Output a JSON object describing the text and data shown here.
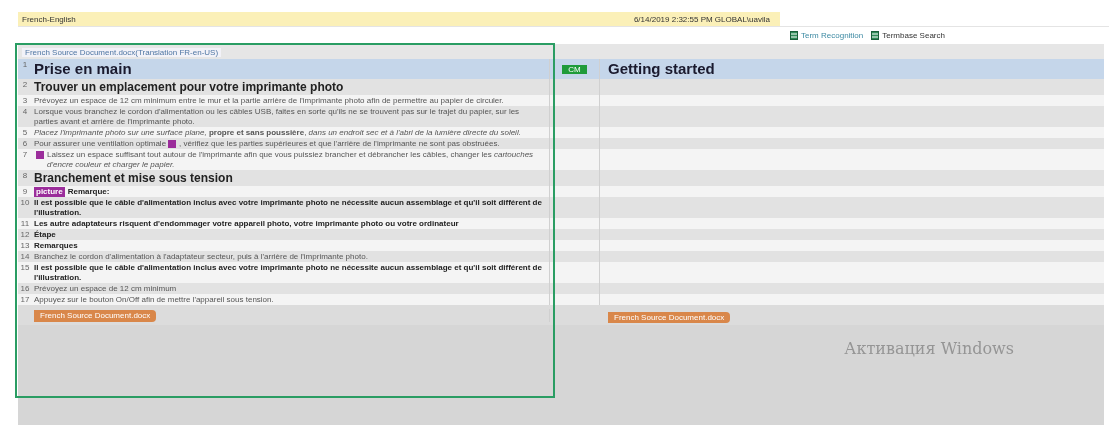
{
  "header": {
    "title": "French-English",
    "info": "6/14/2019 2:32:55 PM  GLOBAL\\uavila"
  },
  "side_tabs": [
    {
      "label": "Term Recognition",
      "selected": true
    },
    {
      "label": "Termbase Search",
      "selected": false
    }
  ],
  "document_tag": "French Source Document.docx(Translation FR-en-US)",
  "segments": [
    {
      "number": "1",
      "kind": "heading1",
      "selected": true,
      "parts": [
        {
          "kind": "text",
          "text": "Prise en main"
        }
      ],
      "status": "CM",
      "target": "Getting started"
    },
    {
      "number": "2",
      "kind": "heading2",
      "selected": false,
      "parts": [
        {
          "kind": "text",
          "text": "Trouver un emplacement pour votre imprimante photo"
        }
      ]
    },
    {
      "number": "3",
      "kind": "normal",
      "selected": false,
      "parts": [
        {
          "kind": "text",
          "text": "Prévoyez un espace de 12 cm minimum entre le mur et la partie arrière de l'imprimante photo afin de permettre au papier de circuler."
        }
      ]
    },
    {
      "number": "4",
      "kind": "normal",
      "selected": false,
      "parts": [
        {
          "kind": "text",
          "text": "Lorsque vous branchez le cordon d'alimentation ou les câbles USB, faites en sorte qu'ils ne se trouvent pas sur le trajet du papier, sur les parties avant et arrière de l'imprimante photo."
        }
      ]
    },
    {
      "number": "5",
      "kind": "normal",
      "selected": false,
      "parts": [
        {
          "kind": "text",
          "text": "*Placez l'imprimante photo sur une surface plane,* **propre et sans poussière**, *dans un endroit sec et à l'abri de la lumière directe du soleil.*"
        }
      ]
    },
    {
      "number": "6",
      "kind": "normal",
      "selected": false,
      "parts": [
        {
          "kind": "text",
          "text": "Pour assurer une ventilation optimale"
        },
        {
          "kind": "tag"
        },
        {
          "kind": "text",
          "text": ", vérifiez que les parties supérieures et que l'arrière de l'imprimante ne sont pas obstruées."
        }
      ]
    },
    {
      "number": "7",
      "kind": "normal",
      "selected": false,
      "parts": [
        {
          "kind": "tag"
        },
        {
          "kind": "text",
          "text": " Laissez un espace suffisant tout autour de l'imprimante afin que vous puissiez brancher et débrancher les câbles, changer les *cartouches d'encre couleur et charger le papier.*"
        }
      ]
    },
    {
      "number": "8",
      "kind": "heading3",
      "selected": false,
      "parts": [
        {
          "kind": "text",
          "text": "Branchement et mise sous tension"
        }
      ]
    },
    {
      "number": "9",
      "kind": "bold",
      "selected": false,
      "parts": [
        {
          "kind": "tag",
          "text": "picture"
        },
        {
          "kind": "text",
          "text": "Remarque:"
        }
      ]
    },
    {
      "number": "10",
      "kind": "bold",
      "selected": false,
      "parts": [
        {
          "kind": "text",
          "text": "Il est possible que le câble d'alimentation inclus avec votre imprimante photo ne nécessite aucun assemblage et qu'il soit différent de l'illustration."
        }
      ]
    },
    {
      "number": "11",
      "kind": "bold",
      "selected": false,
      "parts": [
        {
          "kind": "text",
          "text": "Les autre adaptateurs risquent d'endommager votre appareil photo, votre imprimante photo ou votre ordinateur"
        }
      ]
    },
    {
      "number": "12",
      "kind": "bold",
      "selected": false,
      "parts": [
        {
          "kind": "text",
          "text": "Étape"
        }
      ]
    },
    {
      "number": "13",
      "kind": "bold",
      "selected": false,
      "parts": [
        {
          "kind": "text",
          "text": "Remarques"
        }
      ]
    },
    {
      "number": "14",
      "kind": "normal",
      "selected": false,
      "parts": [
        {
          "kind": "text",
          "text": "Branchez le cordon d'alimentation à l'adaptateur secteur, puis à l'arrière de l'imprimante photo."
        }
      ]
    },
    {
      "number": "15",
      "kind": "small-bold",
      "selected": false,
      "parts": [
        {
          "kind": "text",
          "text": "Il est possible que le câble d'alimentation inclus avec votre imprimante photo ne nécessite aucun assemblage et qu'il soit différent de l'illustration."
        }
      ]
    },
    {
      "number": "16",
      "kind": "normal",
      "selected": false,
      "parts": [
        {
          "kind": "text",
          "text": "Prévoyez un espace de 12 cm minimum"
        }
      ]
    },
    {
      "number": "17",
      "kind": "normal",
      "selected": false,
      "parts": [
        {
          "kind": "text",
          "text": "Appuyez sur le bouton On/Off afin de mettre l'appareil sous tension."
        }
      ]
    }
  ],
  "source_end_tag": "French Source Document.docx",
  "target_end_tag": "French Source Document.docx",
  "os_notice": "Активация Windows"
}
